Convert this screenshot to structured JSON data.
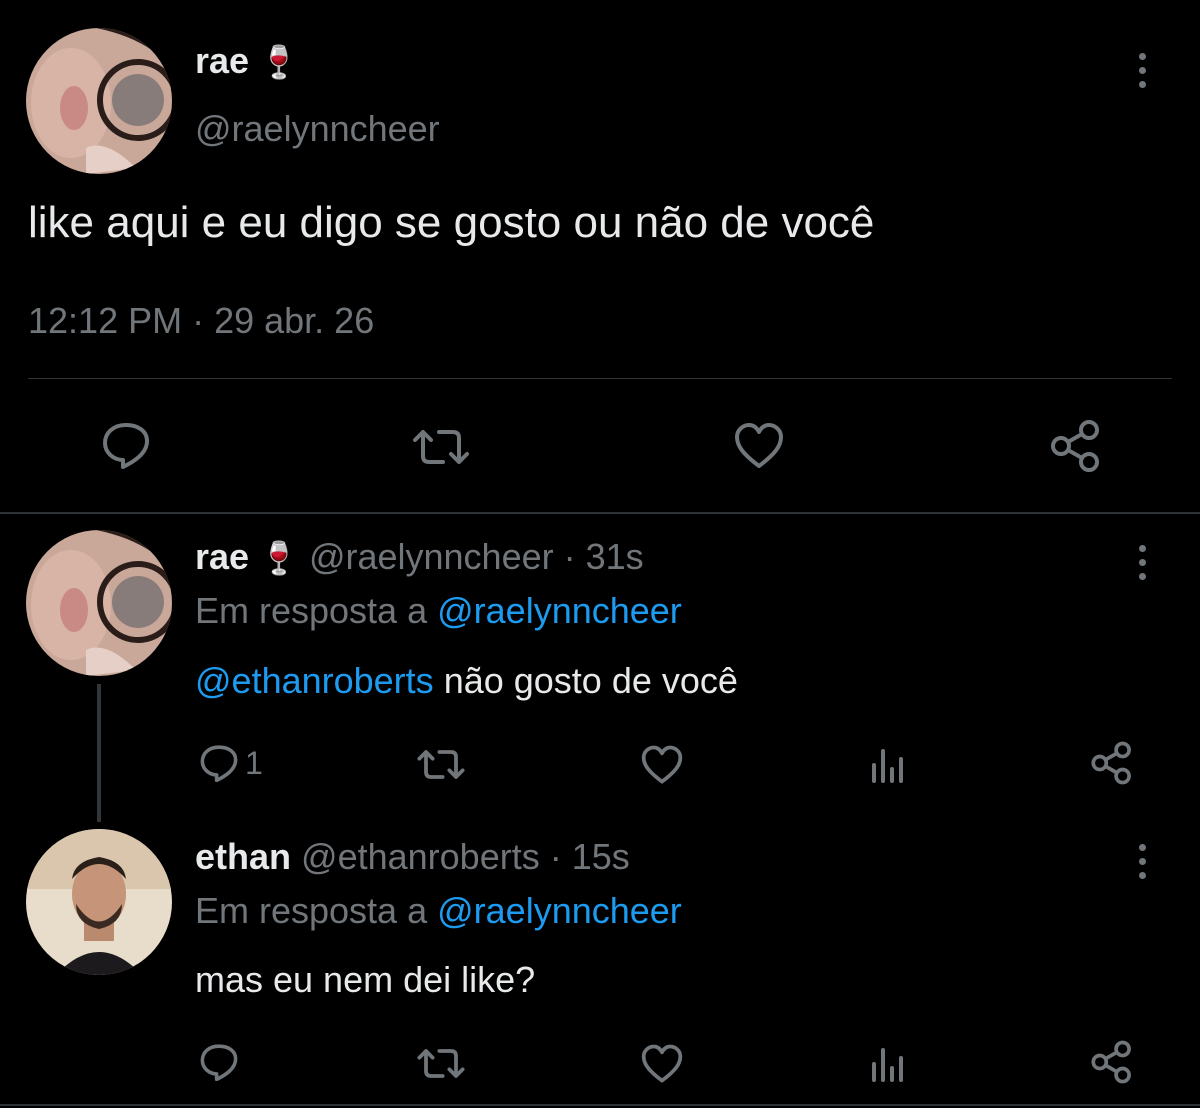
{
  "main_tweet": {
    "display_name": "rae",
    "name_emoji": "🍷",
    "handle": "@raelynncheer",
    "text": "like aqui e eu digo se gosto ou não de você",
    "timestamp": "12:12 PM · 29 abr. 26"
  },
  "replies": [
    {
      "display_name": "rae",
      "name_emoji": "🍷",
      "handle_time": "@raelynncheer · 31s",
      "reply_prefix": "Em resposta a",
      "reply_to": "@raelynncheer",
      "mention": "@ethanroberts",
      "text": " não gosto de você",
      "reply_count": "1"
    },
    {
      "display_name": "ethan",
      "handle_time": "@ethanroberts · 15s",
      "reply_prefix": "Em resposta a",
      "reply_to": "@raelynncheer",
      "text": "mas eu nem dei like?"
    }
  ],
  "icons": [
    "reply-icon",
    "retweet-icon",
    "like-icon",
    "share-icon",
    "views-icon",
    "more-icon"
  ],
  "colors": {
    "background": "#000000",
    "text": "#e7e9ea",
    "muted": "#71767b",
    "link": "#1d9bf0",
    "divider": "#2f3336"
  }
}
